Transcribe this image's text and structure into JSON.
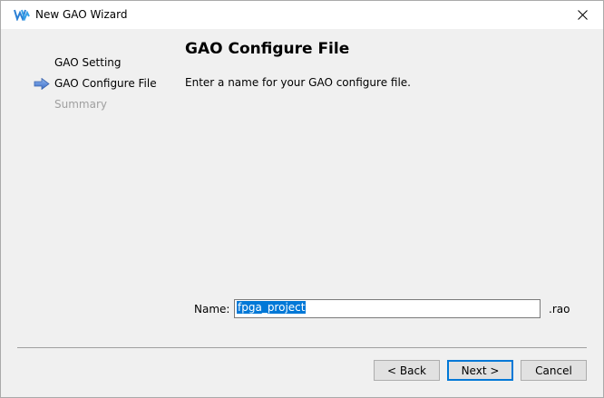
{
  "window": {
    "title": "New GAO Wizard"
  },
  "steps": [
    {
      "label": "GAO Setting",
      "state": "done"
    },
    {
      "label": "GAO Configure File",
      "state": "current"
    },
    {
      "label": "Summary",
      "state": "pending"
    }
  ],
  "page": {
    "heading": "GAO Configure File",
    "description": "Enter a name for your GAO configure file."
  },
  "form": {
    "name_label": "Name:",
    "name_value": "fpga_project",
    "extension": ".rao"
  },
  "buttons": {
    "back": "< Back",
    "next": "Next >",
    "cancel": "Cancel"
  },
  "colors": {
    "accent": "#0078d7",
    "disabled_text": "#a0a0a0",
    "arrow": "#4f7fd1"
  },
  "icons": {
    "app": "gowin-logo-icon",
    "close": "close-icon",
    "current_step": "arrow-right-icon"
  }
}
